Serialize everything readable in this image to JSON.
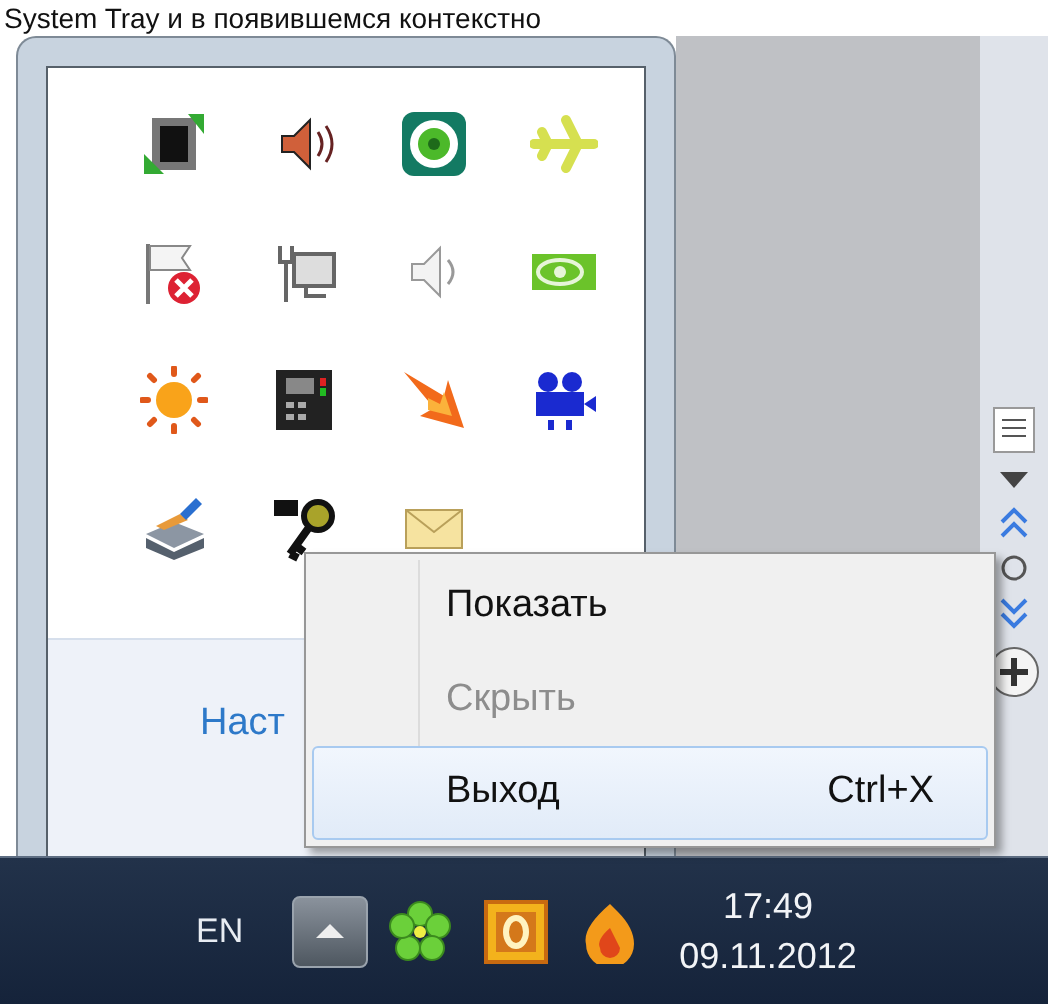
{
  "caption": "System Tray и в появившемся контекстно",
  "tray_popup": {
    "customize_link": "Наст"
  },
  "context_menu": {
    "items": [
      {
        "label": "Показать",
        "disabled": false,
        "selected": false
      },
      {
        "label": "Скрыть",
        "disabled": true,
        "selected": false
      },
      {
        "label": "Выход",
        "shortcut": "Ctrl+X",
        "disabled": false,
        "selected": true
      }
    ]
  },
  "taskbar": {
    "language": "EN",
    "time": "17:49",
    "date": "09.11.2012"
  }
}
